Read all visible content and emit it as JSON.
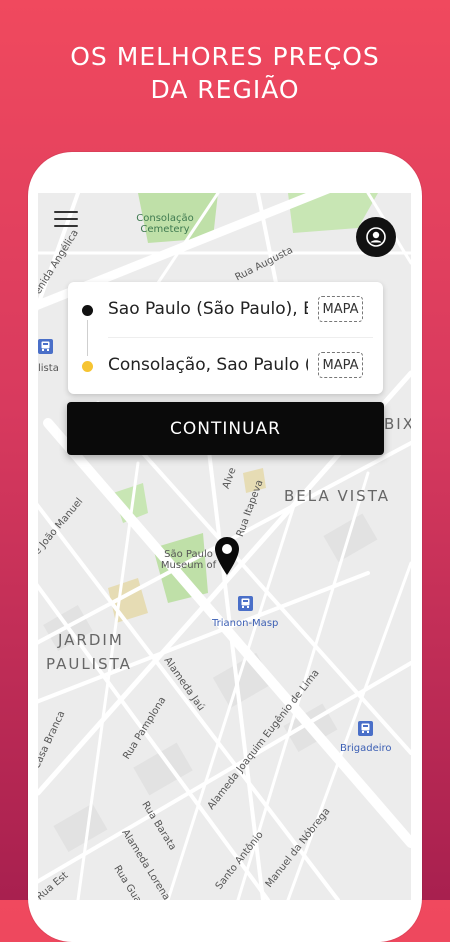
{
  "headline": {
    "line1": "OS MELHORES PREÇOS",
    "line2": "DA REGIÃO"
  },
  "route": {
    "origin_text": "Sao Paulo (São Paulo), B",
    "destination_text": "Consolação, Sao Paulo (S",
    "origin_map_label": "MAPA",
    "destination_map_label": "MAPA"
  },
  "continue_label": "CONTINUAR",
  "map": {
    "areas": {
      "bela_vista": "BELA VISTA",
      "jardim": "JARDIM",
      "paulista": "PAULISTA",
      "bix": "BIX"
    },
    "pois": {
      "cemetery_line1": "Consolação",
      "cemetery_line2": "Cemetery",
      "museum_line1": "São Paulo",
      "museum_line2": "Museum of",
      "trianon": "Trianon-Masp",
      "brigadeiro": "Brigadeiro",
      "lista": "lista"
    },
    "streets": {
      "rua_augusta": "Rua Augusta",
      "angelica": "venida Angélica",
      "itapeva": "Rua Itapeva",
      "joao_manuel": "e João Manuel",
      "jau": "Alameda Jaú",
      "casa_branca": "Casa Branca",
      "pamplona": "Rua Pamplona",
      "eugenio": "Alameda Joaquim Eugênio de Lima",
      "barata": "Rua Barata",
      "lorena": "Alameda Lorena",
      "guarara": "Rua Guarar",
      "santo_antonio": "Santo Antônio",
      "nobrega": "Manuel da Nóbrega",
      "estados": "Rua Est",
      "alv": "Alve"
    }
  },
  "colors": {
    "background_top": "#f0495e",
    "background_bottom": "#a8204f",
    "button": "#0a0a0a",
    "destination_dot": "#f6c432",
    "metro": "#4a6fc8",
    "park": "#bfe0a8"
  },
  "icons": {
    "menu": "hamburger-menu-icon",
    "profile": "user-profile-icon",
    "pin": "location-pin-icon",
    "metro": "metro-station-icon"
  }
}
